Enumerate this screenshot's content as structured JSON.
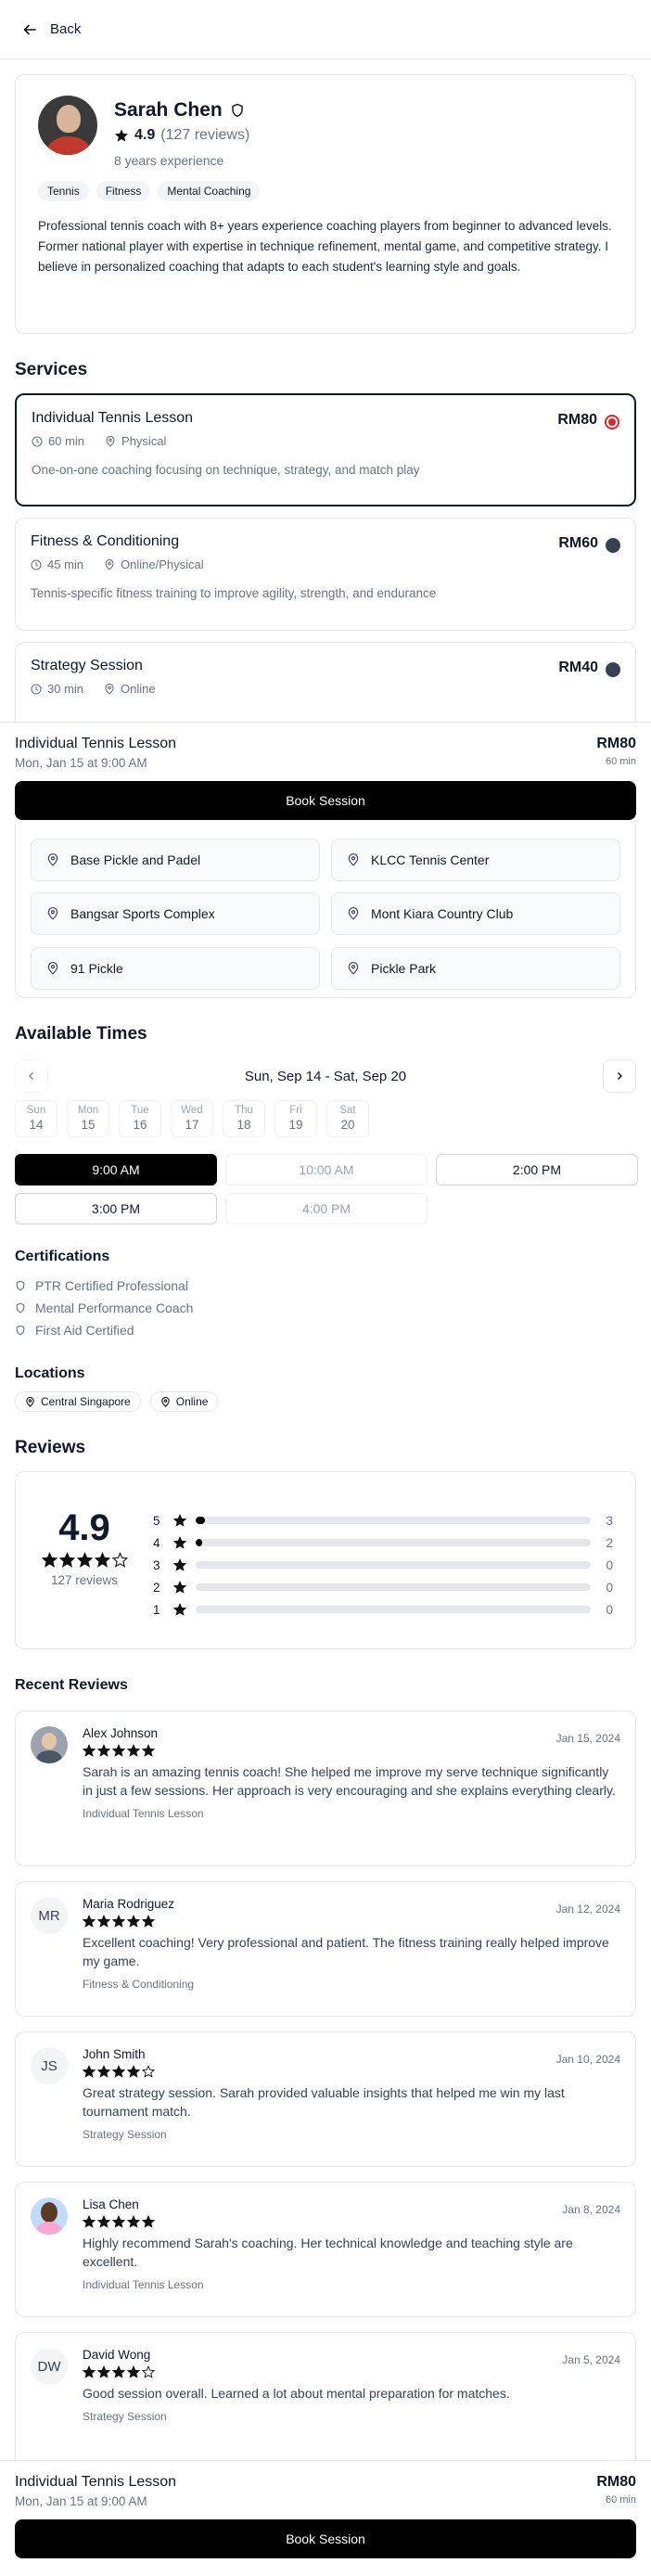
{
  "header": {
    "back_label": "Back"
  },
  "coach": {
    "name": "Sarah Chen",
    "rating": "4.9",
    "review_count": "(127 reviews)",
    "experience": "8 years experience",
    "tags": [
      "Tennis",
      "Fitness",
      "Mental Coaching"
    ],
    "bio": "Professional tennis coach with 8+ years experience coaching players from beginner to advanced levels. Former national player with expertise in technique refinement, mental game, and competitive strategy. I believe in personalized coaching that adapts to each student's learning style and goals."
  },
  "services": {
    "title": "Services",
    "items": [
      {
        "name": "Individual Tennis Lesson",
        "duration": "60 min",
        "mode": "Physical",
        "price": "RM80",
        "desc": "One-on-one coaching focusing on technique, strategy, and match play",
        "selected": true
      },
      {
        "name": "Fitness & Conditioning",
        "duration": "45 min",
        "mode": "Online/Physical",
        "price": "RM60",
        "desc": "Tennis-specific fitness training to improve agility, strength, and endurance",
        "selected": false
      },
      {
        "name": "Strategy Session",
        "duration": "30 min",
        "mode": "Online",
        "price": "RM40",
        "desc": "",
        "selected": false
      }
    ]
  },
  "booking": {
    "service": "Individual Tennis Lesson",
    "datetime": "Mon, Jan 15 at 9:00 AM",
    "price": "RM80",
    "duration": "60 min",
    "button": "Book Session"
  },
  "venues": [
    "Base Pickle and Padel",
    "KLCC Tennis Center",
    "Bangsar Sports Complex",
    "Mont Kiara Country Club",
    "91 Pickle",
    "Pickle Park"
  ],
  "times": {
    "title": "Available Times",
    "week_label": "Sun, Sep 14 - Sat, Sep 20",
    "days": [
      {
        "dow": "Sun",
        "d": "14"
      },
      {
        "dow": "Mon",
        "d": "15"
      },
      {
        "dow": "Tue",
        "d": "16"
      },
      {
        "dow": "Wed",
        "d": "17"
      },
      {
        "dow": "Thu",
        "d": "18"
      },
      {
        "dow": "Fri",
        "d": "19"
      },
      {
        "dow": "Sat",
        "d": "20"
      }
    ],
    "slots": [
      {
        "label": "9:00 AM",
        "state": "active"
      },
      {
        "label": "10:00 AM",
        "state": "unavail"
      },
      {
        "label": "2:00 PM",
        "state": "avail"
      },
      {
        "label": "3:00 PM",
        "state": "avail"
      },
      {
        "label": "4:00 PM",
        "state": "unavail"
      }
    ]
  },
  "certifications": {
    "title": "Certifications",
    "items": [
      "PTR Certified Professional",
      "Mental Performance Coach",
      "First Aid Certified"
    ]
  },
  "locations": {
    "title": "Locations",
    "items": [
      "Central Singapore",
      "Online"
    ]
  },
  "reviews": {
    "title": "Reviews",
    "rating": "4.9",
    "stars": 4,
    "count": "127 reviews",
    "distribution": [
      {
        "level": "5",
        "count": "3",
        "fraction": 0.0
      },
      {
        "level": "4",
        "count": "2",
        "fraction": 0.0
      },
      {
        "level": "3",
        "count": "0",
        "fraction": 0
      },
      {
        "level": "2",
        "count": "0",
        "fraction": 0
      },
      {
        "level": "1",
        "count": "0",
        "fraction": 0
      }
    ],
    "recent_title": "Recent Reviews",
    "items": [
      {
        "name": "Alex Johnson",
        "initials": "",
        "avatar": "photo-a",
        "stars": 5,
        "date": "Jan 15, 2024",
        "text": "Sarah is an amazing tennis coach! She helped me improve my serve technique significantly in just a few sessions. Her approach is very encouraging and she explains everything clearly.",
        "service": "Individual Tennis Lesson"
      },
      {
        "name": "Maria Rodriguez",
        "initials": "MR",
        "avatar": "",
        "stars": 5,
        "date": "Jan 12, 2024",
        "text": "Excellent coaching! Very professional and patient. The fitness training really helped improve my game.",
        "service": "Fitness & Conditioning"
      },
      {
        "name": "John Smith",
        "initials": "JS",
        "avatar": "",
        "stars": 4,
        "date": "Jan 10, 2024",
        "text": "Great strategy session. Sarah provided valuable insights that helped me win my last tournament match.",
        "service": "Strategy Session"
      },
      {
        "name": "Lisa Chen",
        "initials": "",
        "avatar": "photo-l",
        "stars": 5,
        "date": "Jan 8, 2024",
        "text": "Highly recommend Sarah's coaching. Her technical knowledge and teaching style are excellent.",
        "service": "Individual Tennis Lesson"
      },
      {
        "name": "David Wong",
        "initials": "DW",
        "avatar": "",
        "stars": 4,
        "date": "Jan 5, 2024",
        "text": "Good session overall. Learned a lot about mental preparation for matches.",
        "service": "Strategy Session"
      }
    ]
  },
  "colors": {
    "primary": "#000000",
    "selected_radio": "#dc2626",
    "muted": "#6b7280",
    "border": "#e5e7eb"
  }
}
